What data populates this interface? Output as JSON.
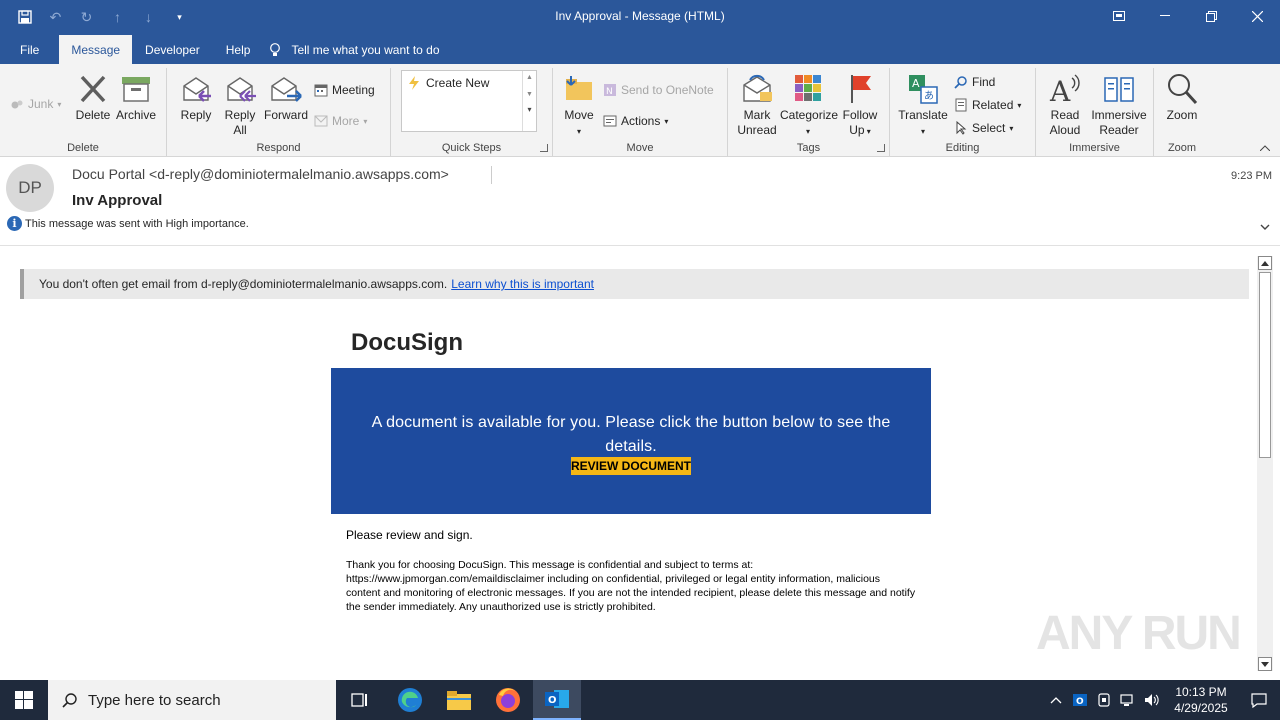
{
  "window": {
    "title": "Inv Approval  -  Message (HTML)"
  },
  "tabs": [
    {
      "label": "File"
    },
    {
      "label": "Message"
    },
    {
      "label": "Developer"
    },
    {
      "label": "Help"
    }
  ],
  "tell_me": "Tell me what you want to do",
  "ribbon": {
    "delete_group": {
      "label": "Delete",
      "junk": "Junk",
      "delete": "Delete",
      "archive": "Archive"
    },
    "respond_group": {
      "label": "Respond",
      "reply": "Reply",
      "reply_all_1": "Reply",
      "reply_all_2": "All",
      "forward": "Forward",
      "meeting": "Meeting",
      "more": "More"
    },
    "quick_steps": {
      "label": "Quick Steps",
      "create_new": "Create New"
    },
    "move_group": {
      "label": "Move",
      "move": "Move",
      "send_onenote": "Send to OneNote",
      "actions": "Actions"
    },
    "tags_group": {
      "label": "Tags",
      "mark_unread_1": "Mark",
      "mark_unread_2": "Unread",
      "categorize": "Categorize",
      "follow_1": "Follow",
      "follow_2": "Up"
    },
    "editing_group": {
      "label": "Editing",
      "translate": "Translate",
      "find": "Find",
      "related": "Related",
      "select": "Select"
    },
    "immersive_group": {
      "label": "Immersive",
      "read_aloud_1": "Read",
      "read_aloud_2": "Aloud",
      "reader_1": "Immersive",
      "reader_2": "Reader"
    },
    "zoom_group": {
      "label": "Zoom",
      "zoom": "Zoom"
    }
  },
  "message": {
    "avatar_initials": "DP",
    "from": "Docu Portal <d-reply@dominiotermalelmanio.awsapps.com>",
    "subject": "Inv Approval",
    "time": "9:23 PM",
    "importance": "This message was sent with High importance."
  },
  "body": {
    "warning_text": "You don't often get email from d-reply@dominiotermalelmanio.awsapps.com.",
    "warning_link": "Learn why this is important",
    "brand": "DocuSign",
    "banner_text": "A document is available for you. Please click the button below to see the details.",
    "review_button": "REVIEW DOCUMENT",
    "please_sign": "Please review and sign.",
    "disclaimer": "Thank you for choosing DocuSign. This message is confidential and subject to terms at: https://www.jpmorgan.com/emaildisclaimer including on confidential, privileged or legal entity information, malicious content and monitoring of electronic messages. If you are not the intended recipient, please delete this message and notify the sender immediately. Any unauthorized use is strictly prohibited."
  },
  "watermark": "ANY RUN",
  "taskbar": {
    "search_placeholder": "Type here to search",
    "time": "10:13 PM",
    "date": "4/29/2025"
  },
  "colors": {
    "accent": "#2b579a",
    "banner": "#1e4b9e",
    "button": "#f5b716"
  }
}
